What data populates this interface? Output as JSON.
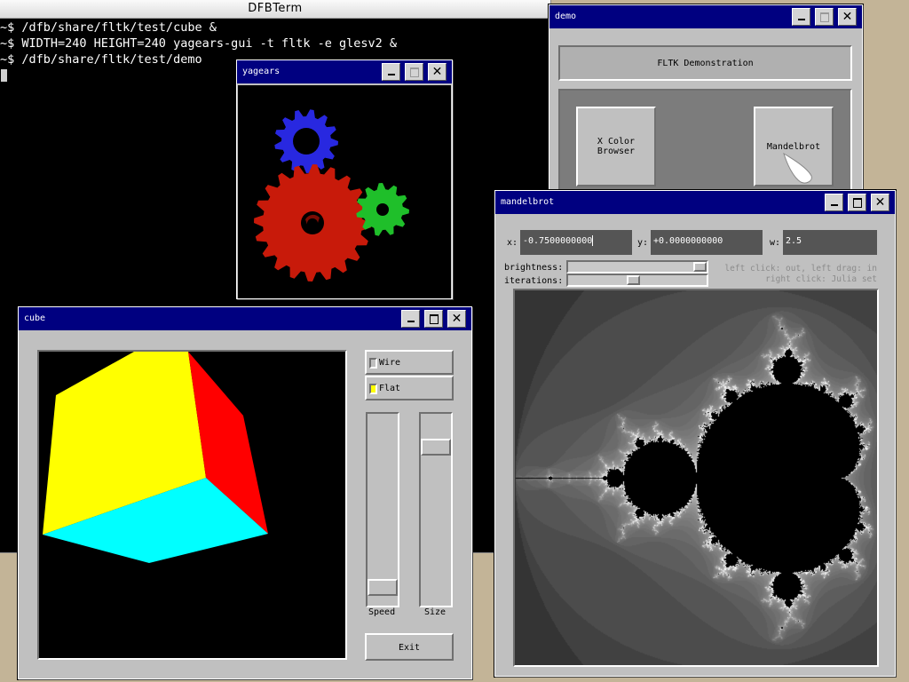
{
  "terminal": {
    "title": "DFBTerm",
    "lines": [
      "~$ /dfb/share/fltk/test/cube &",
      "~$ WIDTH=240 HEIGHT=240 yagears-gui -t fltk -e glesv2 &",
      "~$ /dfb/share/fltk/test/demo"
    ]
  },
  "yagears": {
    "title": "yagears",
    "close": "✕"
  },
  "demo": {
    "title": "demo",
    "header": "FLTK Demonstration",
    "button_color_browser": "X Color Browser",
    "button_mandelbrot": "Mandelbrot",
    "close": "✕"
  },
  "cube": {
    "title": "cube",
    "wire_label": "Wire",
    "flat_label": "Flat",
    "speed_label": "Speed",
    "size_label": "Size",
    "exit_label": "Exit",
    "close": "✕",
    "colors": {
      "top": "#ffff00",
      "right": "#ff0000",
      "bottom": "#00ffff",
      "flat_check": "#ffff00"
    }
  },
  "mandelbrot": {
    "title": "mandelbrot",
    "x_label": "x:",
    "x_value": "-0.7500000000",
    "y_label": "y:",
    "y_value": "+0.0000000000",
    "w_label": "w:",
    "w_value": "2.5",
    "brightness_label": "brightness:",
    "iterations_label": "iterations:",
    "help_line1": "left click: out, left drag: in",
    "help_line2": "right click: Julia set",
    "close": "✕"
  }
}
